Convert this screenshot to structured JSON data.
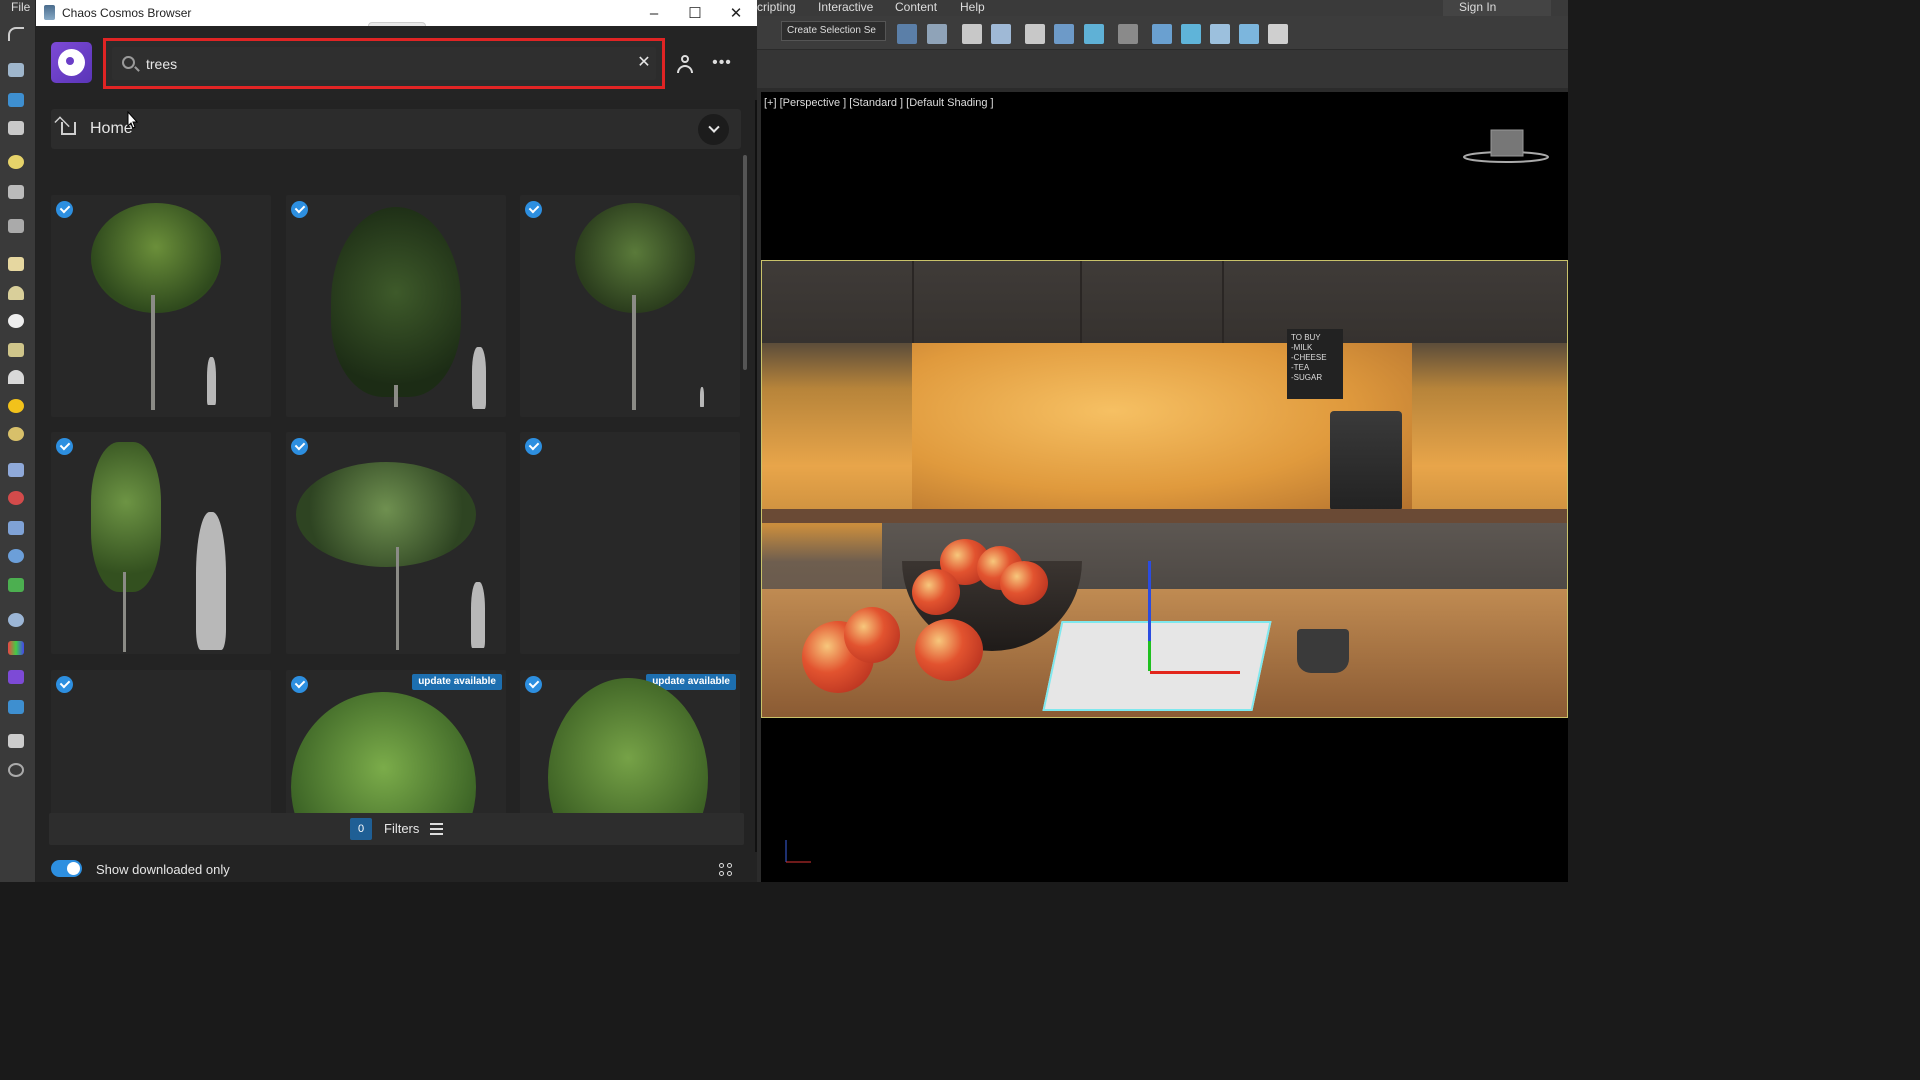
{
  "host": {
    "file_menu": "File",
    "menu": [
      "cripting",
      "Interactive",
      "Content",
      "Help"
    ],
    "sign_in": "Sign In",
    "selection_set": "Create Selection Se",
    "viewport_label": "[+] [Perspective ] [Standard ] [Default Shading ]",
    "chalkboard_text": "TO BUY\n-MILK\n-CHEESE\n-TEA\n-SUGAR"
  },
  "window": {
    "title": "Chaos Cosmos Browser",
    "minimize": "–",
    "maximize": "☐",
    "close": "✕"
  },
  "search": {
    "value": "trees",
    "clear_glyph": "✕"
  },
  "header": {
    "more_glyph": "•••"
  },
  "breadcrumb": {
    "label": "Home"
  },
  "assets": [
    {
      "checked": true,
      "badge": ""
    },
    {
      "checked": true,
      "badge": ""
    },
    {
      "checked": true,
      "badge": ""
    },
    {
      "checked": true,
      "badge": ""
    },
    {
      "checked": true,
      "badge": ""
    },
    {
      "checked": true,
      "badge": ""
    },
    {
      "checked": true,
      "badge": ""
    },
    {
      "checked": true,
      "badge": "update available"
    },
    {
      "checked": true,
      "badge": "update available"
    }
  ],
  "filters": {
    "count": "0",
    "label": "Filters"
  },
  "footer": {
    "toggle_label": "Show downloaded only",
    "toggle_on": true
  },
  "colors": {
    "accent": "#2d8fe0",
    "search_highlight": "#e02424",
    "logo": "#6a3dc7"
  }
}
